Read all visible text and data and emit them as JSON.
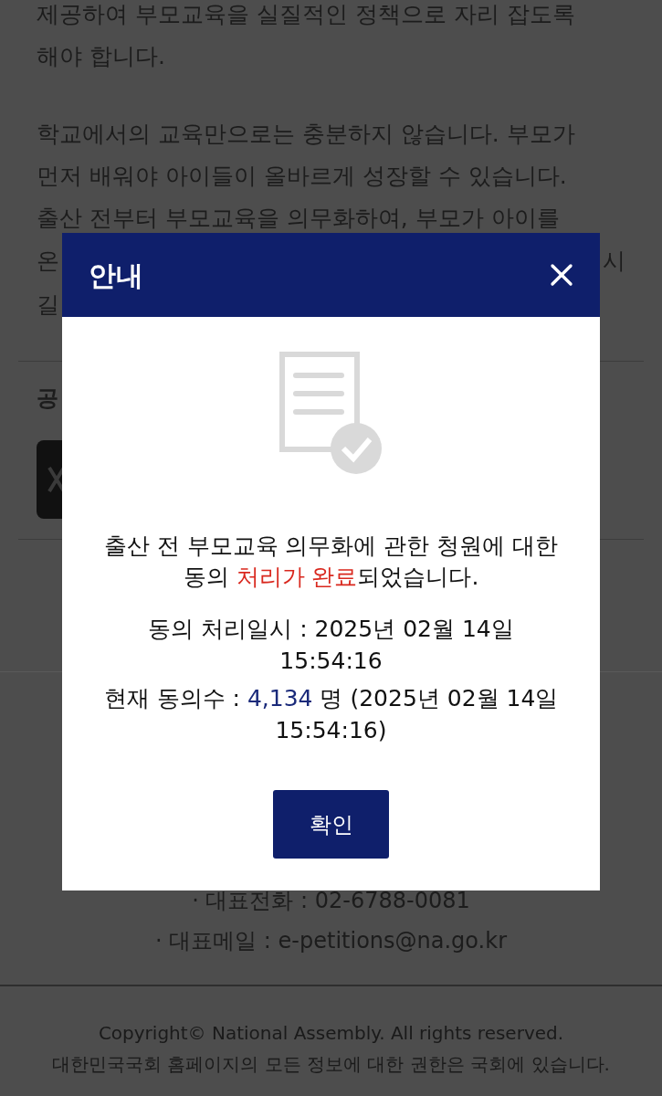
{
  "page": {
    "paragraphs": [
      [
        "제공하여 부모교육을 실질적인 정책으로 자리 잡도록",
        "해야 합니다."
      ],
      [
        "학교에서의 교육만으로는 충분하지 않습니다. 부모가",
        "먼저 배워야 아이들이 올바르게 성장할 수 있습니다.",
        "출산 전부터 부모교육을 의무화하여, 부모가 아이를"
      ]
    ],
    "partial_lines": [
      {
        "left": "온",
        "right": "시"
      },
      {
        "left": "길"
      }
    ],
    "section_label": "공",
    "footer_lines": [
      "· 대표전화 : 02-6788-0081",
      "· 대표메일 : e-petitions@na.go.kr"
    ],
    "copyright": [
      "Copyright© National Assembly. All rights reserved.",
      "대한민국국회 홈페이지의 모든 정보에 대한 권한은 국회에 있습니다."
    ]
  },
  "dialog": {
    "title": "안내",
    "message": {
      "before": "출산 전 부모교육 의무화에 관한 청원에 대한 동의 ",
      "highlight": "처리가 완료",
      "after": "되었습니다."
    },
    "processed_at": "동의 처리일시 : 2025년 02월 14일 15:54:16",
    "count": {
      "label": "현재 동의수 : ",
      "value": "4,134",
      "after": " 명 (2025년 02월 14일 15:54:16)"
    },
    "confirm_button": "확인"
  }
}
